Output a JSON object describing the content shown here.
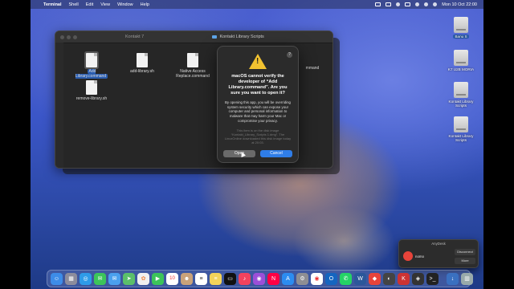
{
  "menubar": {
    "apple": "",
    "app_name": "Terminal",
    "items": [
      "Shell",
      "Edit",
      "View",
      "Window",
      "Help"
    ],
    "clock": "Mon 10 Oct  22:00"
  },
  "finder": {
    "title": "Kontakt Library Scripts",
    "tab_hint": "Kontakt 7",
    "files": [
      {
        "label": "Add Library.command",
        "selected": true
      },
      {
        "label": "add-library.sh",
        "selected": false
      },
      {
        "label": "Native Access Replace.command",
        "selected": false
      },
      {
        "label": "remove-library.sh",
        "selected": false
      }
    ],
    "partial_label": "mmand"
  },
  "dialog": {
    "help": "?",
    "title": "macOS cannot verify the developer of “Add Library.command”. Are you sure you want to open it?",
    "body": "By opening this app, you will be overriding system security which can expose your computer and personal information to malware that may harm your Mac or compromise your privacy.",
    "note": "This item is on the disk image “Kontakt_Library_Scripts 1.dmg”. The LinuxOnline downloaded this disk image today at 20:03.",
    "open_label": "Open",
    "cancel_label": "Cancel"
  },
  "desktop_icons": [
    {
      "label": "Banu S",
      "selected": true
    },
    {
      "label": "K7 U2B MORIA",
      "selected": false
    },
    {
      "label": "Kontakt Library Scripts",
      "selected": false
    },
    {
      "label": "Kontakt Library Scripts",
      "selected": false
    }
  ],
  "anydesk": {
    "title": "AnyDesk",
    "user": "nomo",
    "disconnect": "Disconnect",
    "more": "More"
  },
  "dock": {
    "icons": [
      "finder-icon",
      "launchpad-icon",
      "safari-icon",
      "messages-icon",
      "mail-icon",
      "maps-icon",
      "photos-icon",
      "facetime-icon",
      "calendar-icon",
      "contacts-icon",
      "reminders-icon",
      "notes-icon",
      "tv-icon",
      "music-icon",
      "podcasts-icon",
      "news-icon",
      "appstore-icon",
      "settings-icon",
      "chrome-icon",
      "outlook-icon",
      "whatsapp-icon",
      "word-icon",
      "anydesk-icon",
      "vpn-icon",
      "kontakt-icon",
      "native-access-icon",
      "terminal-icon",
      "downloads-icon",
      "trash-icon"
    ],
    "calendar_day": "10"
  }
}
